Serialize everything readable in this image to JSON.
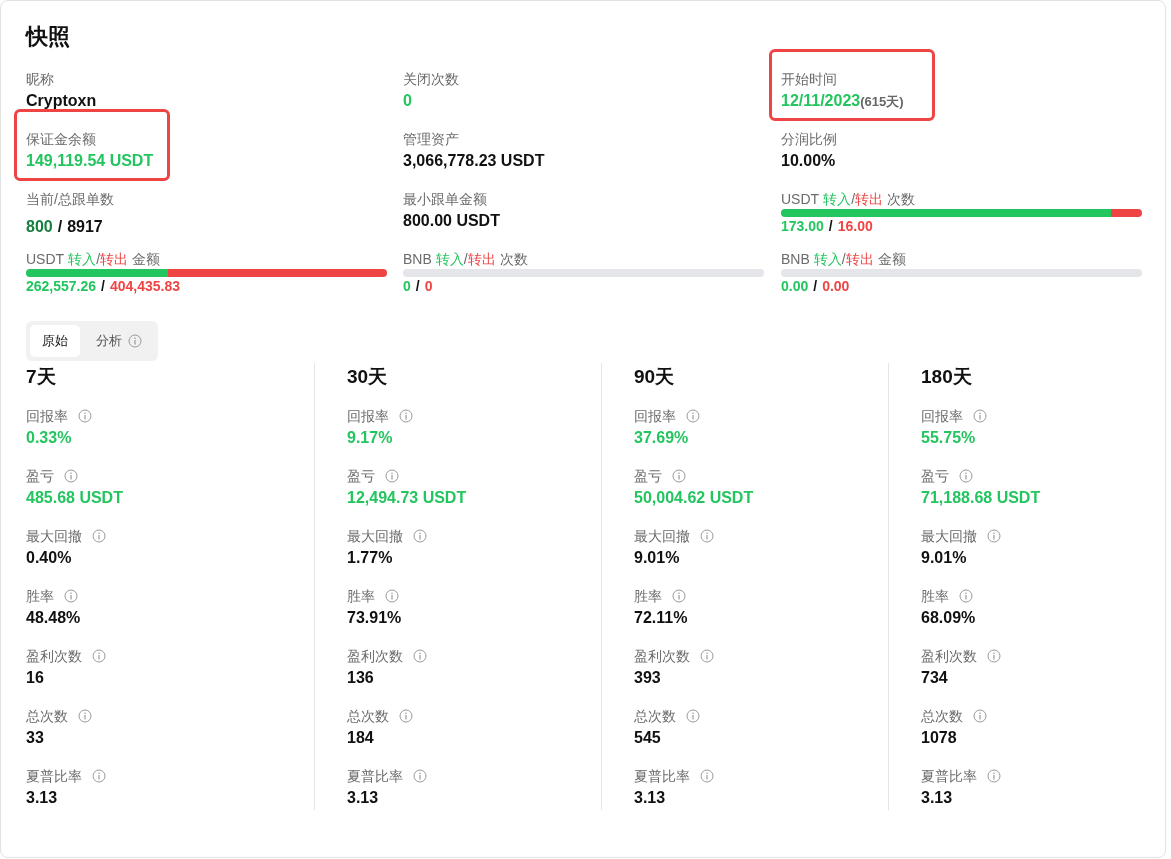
{
  "title": "快照",
  "summary": [
    {
      "kind": "plain",
      "label": "昵称",
      "highlighted": false,
      "parts": [
        {
          "kind": "neutral",
          "text": "Cryptoxn"
        }
      ]
    },
    {
      "kind": "plain",
      "label": "关闭次数",
      "highlighted": false,
      "parts": [
        {
          "kind": "positive",
          "text": "0"
        }
      ]
    },
    {
      "kind": "plain",
      "label": "开始时间",
      "highlighted": true,
      "parts": [
        {
          "kind": "positive",
          "text": "12/11/2023"
        },
        {
          "kind": "note",
          "text": "(615天)"
        }
      ]
    },
    {
      "kind": "plain",
      "label": "保证金余额",
      "highlighted": true,
      "parts": [
        {
          "kind": "positive",
          "text": "149,119.54 USDT"
        }
      ]
    },
    {
      "kind": "plain",
      "label": "管理资产",
      "highlighted": false,
      "parts": [
        {
          "kind": "neutral",
          "text": "3,066,778.23 USDT"
        }
      ]
    },
    {
      "kind": "plain",
      "label": "分润比例",
      "highlighted": false,
      "parts": [
        {
          "kind": "neutral",
          "text": "10.00%"
        }
      ]
    },
    {
      "kind": "plain",
      "label": "当前/总跟单数",
      "highlighted": false,
      "parts": [
        {
          "kind": "strong",
          "text": "800"
        },
        {
          "kind": "separator",
          "text": "/"
        },
        {
          "kind": "neutral",
          "text": "8917"
        }
      ]
    },
    {
      "kind": "plain",
      "label": "最小跟单金额",
      "highlighted": false,
      "parts": [
        {
          "kind": "neutral",
          "text": "800.00 USDT"
        }
      ]
    },
    {
      "kind": "flow",
      "label_parts": [
        {
          "kind": "label",
          "text": "USDT"
        },
        {
          "kind": "positive",
          "text": "转入"
        },
        {
          "kind": "slash",
          "text": "/"
        },
        {
          "kind": "negative",
          "text": "转出"
        },
        {
          "kind": "label",
          "text": "次数"
        }
      ],
      "level": 0.915,
      "active": true,
      "highlighted": false,
      "parts": [
        {
          "kind": "positive",
          "text": "173.00"
        },
        {
          "kind": "separator",
          "text": "/"
        },
        {
          "kind": "negative",
          "text": "16.00"
        }
      ]
    },
    {
      "kind": "flow",
      "label_parts": [
        {
          "kind": "label",
          "text": "USDT"
        },
        {
          "kind": "positive",
          "text": "转入"
        },
        {
          "kind": "slash",
          "text": "/"
        },
        {
          "kind": "negative",
          "text": "转出"
        },
        {
          "kind": "label",
          "text": "金额"
        }
      ],
      "level": 0.394,
      "active": true,
      "highlighted": false,
      "parts": [
        {
          "kind": "positive",
          "text": "262,557.26"
        },
        {
          "kind": "separator",
          "text": "/"
        },
        {
          "kind": "negative",
          "text": "404,435.83"
        }
      ]
    },
    {
      "kind": "flow",
      "label_parts": [
        {
          "kind": "label",
          "text": "BNB"
        },
        {
          "kind": "positive",
          "text": "转入"
        },
        {
          "kind": "slash",
          "text": "/"
        },
        {
          "kind": "negative",
          "text": "转出"
        },
        {
          "kind": "label",
          "text": "次数"
        }
      ],
      "active": false,
      "highlighted": false,
      "parts": [
        {
          "kind": "positive",
          "text": "0"
        },
        {
          "kind": "separator",
          "text": "/"
        },
        {
          "kind": "negative",
          "text": "0"
        }
      ]
    },
    {
      "kind": "flow",
      "label_parts": [
        {
          "kind": "label",
          "text": "BNB"
        },
        {
          "kind": "positive",
          "text": "转入"
        },
        {
          "kind": "slash",
          "text": "/"
        },
        {
          "kind": "negative",
          "text": "转出"
        },
        {
          "kind": "label",
          "text": "金额"
        }
      ],
      "active": false,
      "highlighted": false,
      "parts": [
        {
          "kind": "positive",
          "text": "0.00"
        },
        {
          "kind": "separator",
          "text": "/"
        },
        {
          "kind": "negative",
          "text": "0.00"
        }
      ]
    }
  ],
  "tabs": [
    {
      "label": "原始",
      "selected": true,
      "info": false
    },
    {
      "label": "分析",
      "selected": false,
      "info": true
    }
  ],
  "periods": [
    {
      "title": "7天",
      "metrics": [
        {
          "label": "回报率",
          "value": "0.33%",
          "positive": true
        },
        {
          "label": "盈亏",
          "value": "485.68 USDT",
          "positive": true
        },
        {
          "label": "最大回撤",
          "value": "0.40%",
          "positive": false
        },
        {
          "label": "胜率",
          "value": "48.48%",
          "positive": false
        },
        {
          "label": "盈利次数",
          "value": "16",
          "positive": false
        },
        {
          "label": "总次数",
          "value": "33",
          "positive": false
        },
        {
          "label": "夏普比率",
          "value": "3.13",
          "positive": false
        }
      ]
    },
    {
      "title": "30天",
      "metrics": [
        {
          "label": "回报率",
          "value": "9.17%",
          "positive": true
        },
        {
          "label": "盈亏",
          "value": "12,494.73 USDT",
          "positive": true
        },
        {
          "label": "最大回撤",
          "value": "1.77%",
          "positive": false
        },
        {
          "label": "胜率",
          "value": "73.91%",
          "positive": false
        },
        {
          "label": "盈利次数",
          "value": "136",
          "positive": false
        },
        {
          "label": "总次数",
          "value": "184",
          "positive": false
        },
        {
          "label": "夏普比率",
          "value": "3.13",
          "positive": false
        }
      ]
    },
    {
      "title": "90天",
      "metrics": [
        {
          "label": "回报率",
          "value": "37.69%",
          "positive": true
        },
        {
          "label": "盈亏",
          "value": "50,004.62 USDT",
          "positive": true
        },
        {
          "label": "最大回撤",
          "value": "9.01%",
          "positive": false
        },
        {
          "label": "胜率",
          "value": "72.11%",
          "positive": false
        },
        {
          "label": "盈利次数",
          "value": "393",
          "positive": false
        },
        {
          "label": "总次数",
          "value": "545",
          "positive": false
        },
        {
          "label": "夏普比率",
          "value": "3.13",
          "positive": false
        }
      ]
    },
    {
      "title": "180天",
      "metrics": [
        {
          "label": "回报率",
          "value": "55.75%",
          "positive": true
        },
        {
          "label": "盈亏",
          "value": "71,188.68 USDT",
          "positive": true
        },
        {
          "label": "最大回撤",
          "value": "9.01%",
          "positive": false
        },
        {
          "label": "胜率",
          "value": "68.09%",
          "positive": false
        },
        {
          "label": "盈利次数",
          "value": "734",
          "positive": false
        },
        {
          "label": "总次数",
          "value": "1078",
          "positive": false
        },
        {
          "label": "夏普比率",
          "value": "3.13",
          "positive": false
        }
      ]
    }
  ]
}
